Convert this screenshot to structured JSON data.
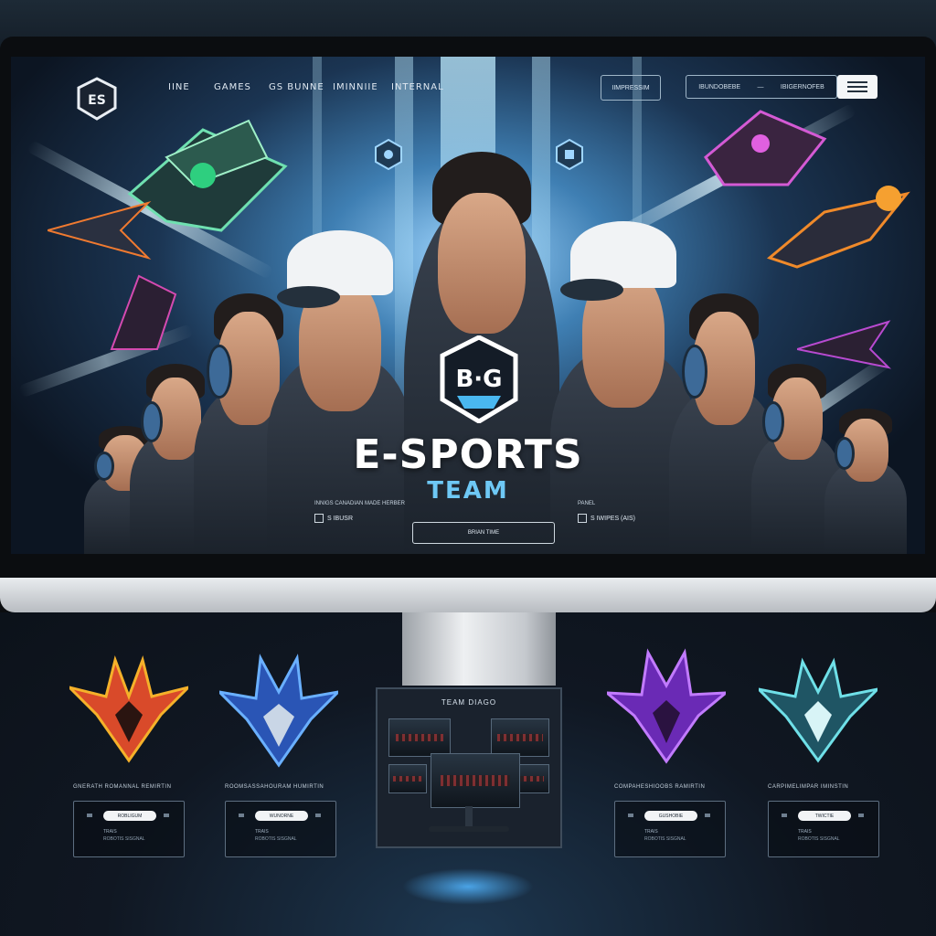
{
  "nav": {
    "items": [
      "IINE",
      "GAMES",
      "GS BUNNE",
      "IMINNIIE",
      "INTERNAL"
    ],
    "button_label": "IIMPRESSIM",
    "search": [
      "IBUNDOBEBE",
      "—",
      "IBIGERNOFEB"
    ]
  },
  "hero": {
    "title": "E-SPORTS",
    "subtitle": "TEAM",
    "logo_text": "B·G",
    "cta_label": "BRIAN TIME",
    "left_meta_label": "INNIGS CANADIAN MADE HERBER",
    "left_meta_value": "S  IBUSR",
    "right_meta_label": "PANEL",
    "right_meta_value": "S  IWIPES (AIS)"
  },
  "colors": {
    "accent": "#6ec8f5",
    "background": "#121a24",
    "emblem_red": "#d94a2a",
    "emblem_blue": "#3a7bd9",
    "emblem_purple": "#8d4ad9",
    "emblem_teal": "#49b8c9"
  },
  "cards": [
    {
      "title": "GNERATH ROMANNAL REMIRTIN",
      "button": "ROBLIGUM",
      "line1": "TRAIS",
      "line2": "ROBOTIS SISGNAL"
    },
    {
      "title": "ROOMSASSAHOURAM HUMIRTIN",
      "button": "WUNORNE",
      "line1": "TRAIS",
      "line2": "ROBOTIS SISGNAL"
    },
    {
      "title": "COMPAHESHIOOBS RAMIRTIN",
      "button": "GUSHOBIE",
      "line1": "TRAIS",
      "line2": "ROBOTIS SISGNAL"
    },
    {
      "title": "CARPIMELIMPAR IMINSTIN",
      "button": "TWICTIE",
      "line1": "TRAIS",
      "line2": "ROBOTIS SISGNAL"
    }
  ],
  "center_panel": {
    "title": "TEAM DIAGO"
  },
  "icons": [
    "team-logo-icon",
    "hex-badge-icon",
    "menu-icon",
    "emblem-icon"
  ]
}
